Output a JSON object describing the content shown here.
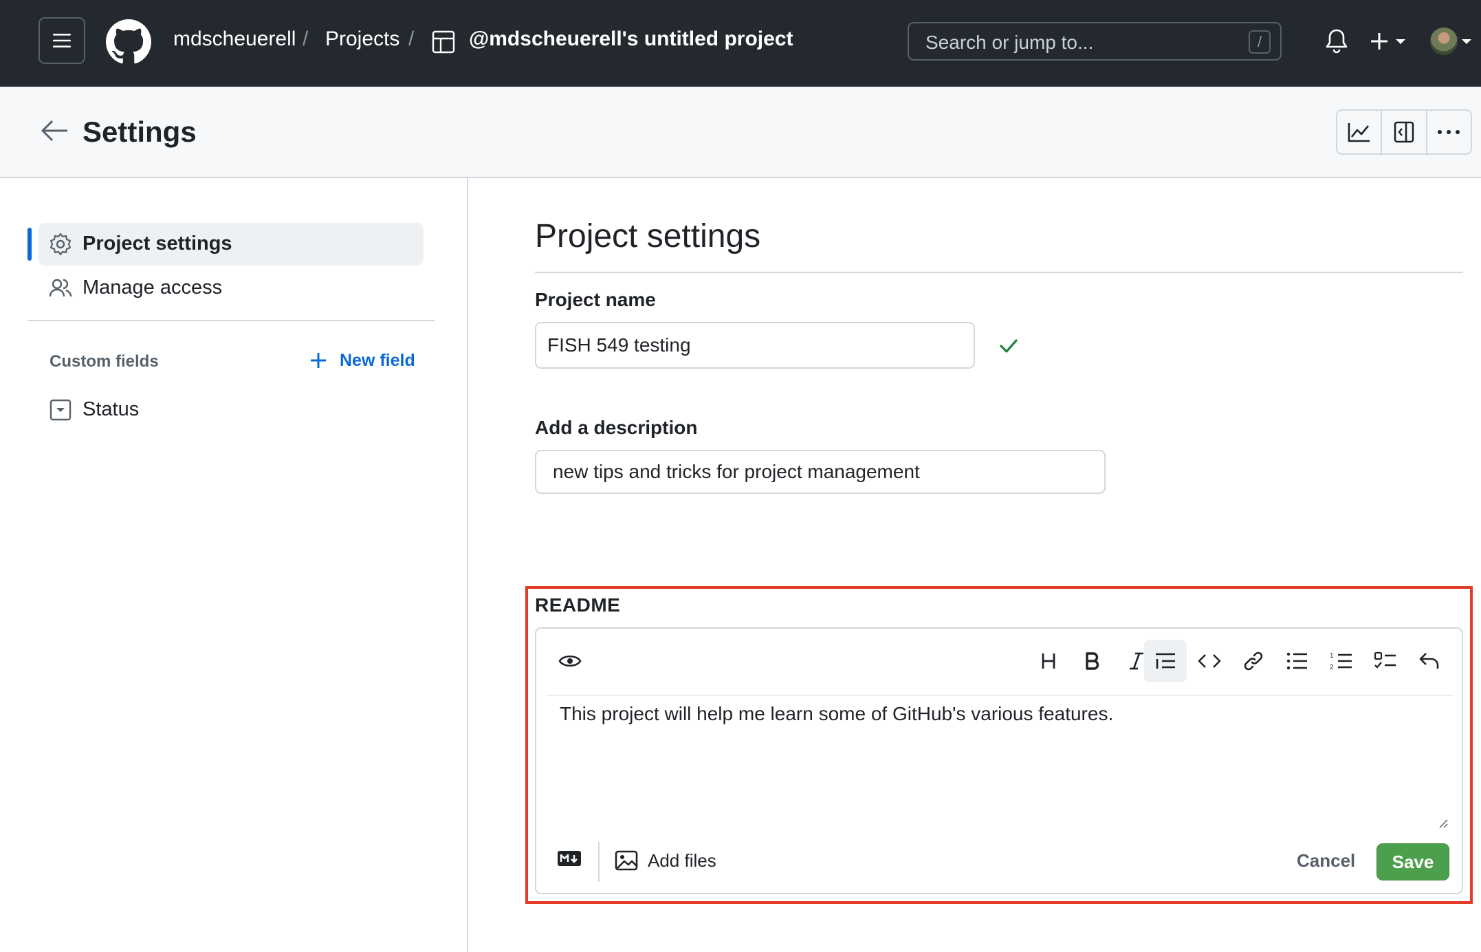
{
  "topbar": {
    "breadcrumb": {
      "owner": "mdscheuerell",
      "section": "Projects",
      "project": "@mdscheuerell's untitled project",
      "separator": "/"
    },
    "search": {
      "placeholder": "Search or jump to...",
      "shortcut": "/"
    },
    "icons": [
      "menu-icon",
      "github-logo-icon",
      "table-icon",
      "bell-icon",
      "plus-icon",
      "caret-down-icon"
    ]
  },
  "subheader": {
    "title": "Settings",
    "actions": [
      "insights-graph-icon",
      "sidebar-panel-icon",
      "kebab-icon"
    ]
  },
  "sidebar": {
    "items": [
      {
        "label": "Project settings",
        "icon": "gear-icon",
        "active": true
      },
      {
        "label": "Manage access",
        "icon": "people-icon",
        "active": false
      }
    ],
    "custom_fields": {
      "heading": "Custom fields",
      "new_field_label": "New field",
      "fields": [
        {
          "label": "Status",
          "icon": "single-select-icon"
        }
      ]
    }
  },
  "main": {
    "title": "Project settings",
    "name_label": "Project name",
    "name_value": "FISH 549 testing",
    "description_label": "Add a description",
    "description_value": "new tips and tricks for project management",
    "readme": {
      "label": "README",
      "content": "This project will help me learn some of GitHub's various features.",
      "toolbar": [
        "preview-eye-icon",
        "heading-icon",
        "bold-icon",
        "italic-icon",
        "quote-icon",
        "code-icon",
        "link-icon",
        "bullet-list-icon",
        "numbered-list-icon",
        "task-list-icon",
        "undo-icon"
      ],
      "add_files_label": "Add files",
      "cancel_label": "Cancel",
      "save_label": "Save"
    }
  },
  "colors": {
    "header_bg": "#24292f",
    "accent_blue": "#0969da",
    "save_green": "#4c9f4c",
    "highlight_red": "#e23d28",
    "check_green": "#1a7f37"
  }
}
